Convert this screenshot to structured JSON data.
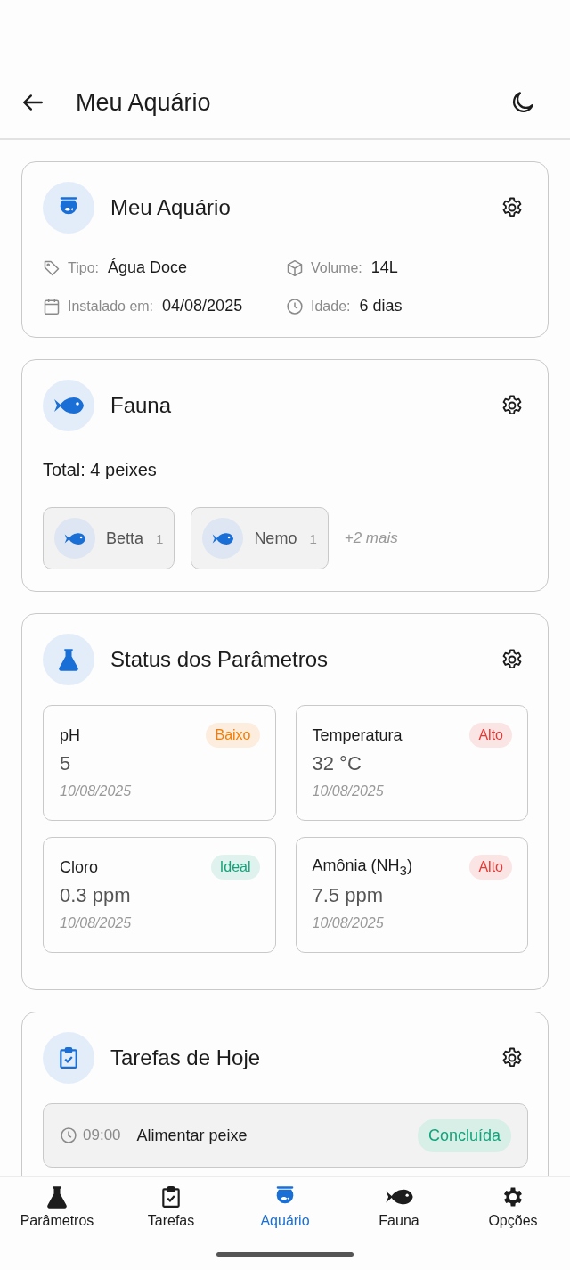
{
  "header": {
    "title": "Meu Aquário"
  },
  "aquarium": {
    "title": "Meu Aquário",
    "details": [
      {
        "label": "Tipo:",
        "value": "Água Doce"
      },
      {
        "label": "Volume:",
        "value": "14L"
      },
      {
        "label": "Instalado em:",
        "value": "04/08/2025"
      },
      {
        "label": "Idade:",
        "value": "6 dias"
      }
    ]
  },
  "fauna": {
    "title": "Fauna",
    "total": "Total: 4 peixes",
    "species": [
      {
        "name": "Betta",
        "count": "1"
      },
      {
        "name": "Nemo",
        "count": "1"
      }
    ],
    "more": "+2 mais"
  },
  "parameters": {
    "title": "Status dos Parâmetros",
    "items": [
      {
        "name": "pH",
        "status": "Baixo",
        "color": "#f57c00",
        "value": "5",
        "date": "10/08/2025"
      },
      {
        "name": "Temperatura",
        "status": "Alto",
        "color": "#e53935",
        "value": "32 °C",
        "date": "10/08/2025"
      },
      {
        "name": "Cloro",
        "status": "Ideal",
        "color": "#12a37a",
        "value": "0.3 ppm",
        "date": "10/08/2025"
      },
      {
        "name": "Amônia (NH$_{3}$)",
        "status": "Alto",
        "color": "#e53935",
        "value": "7.5 ppm",
        "date": "10/08/2025"
      }
    ]
  },
  "tasks": {
    "title": "Tarefas de Hoje",
    "items": [
      {
        "time": "09:00",
        "name": "Alimentar peixe",
        "status": "Concluída",
        "done": true
      }
    ]
  },
  "nav": [
    {
      "label": "Parâmetros",
      "selected": false
    },
    {
      "label": "Tarefas",
      "selected": false
    },
    {
      "label": "Aquário",
      "selected": true
    },
    {
      "label": "Fauna",
      "selected": false
    },
    {
      "label": "Opções",
      "selected": false
    }
  ]
}
